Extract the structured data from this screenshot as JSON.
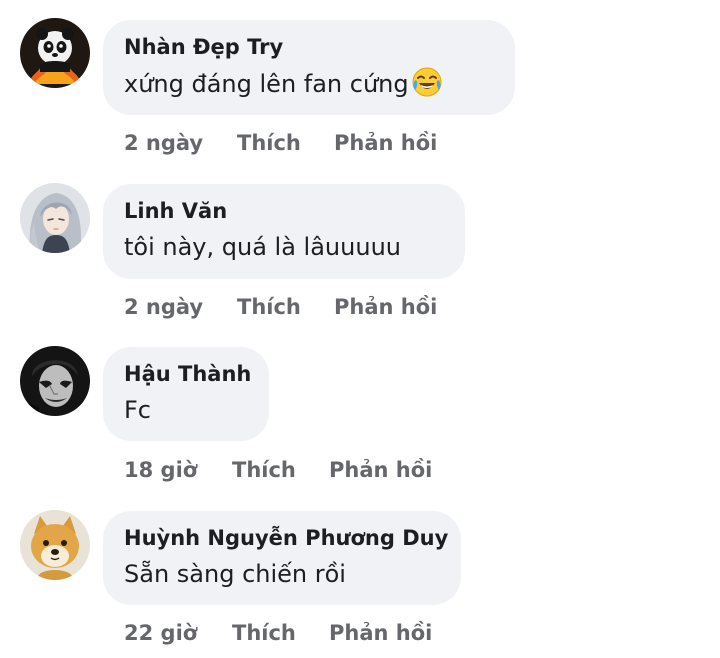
{
  "comments": [
    {
      "author": "Nhàn Đẹp Try",
      "text": "xứng đáng lên fan cứng",
      "emoji": "face-with-tears-of-joy-icon",
      "time": "2 ngày",
      "like_label": "Thích",
      "reply_label": "Phản hồi",
      "avatar": "panda-avatar"
    },
    {
      "author": "Linh Văn",
      "text": "tôi này, quá là lâuuuuu",
      "time": "2 ngày",
      "like_label": "Thích",
      "reply_label": "Phản hồi",
      "avatar": "silver-hair-character-avatar"
    },
    {
      "author": "Hậu Thành",
      "text": "Fc",
      "time": "18 giờ",
      "like_label": "Thích",
      "reply_label": "Phản hồi",
      "avatar": "joker-avatar"
    },
    {
      "author": "Huỳnh Nguyễn Phương Duy",
      "text": "Sẵn sàng chiến rồi",
      "time": "22 giờ",
      "like_label": "Thích",
      "reply_label": "Phản hồi",
      "avatar": "shiba-dog-avatar"
    }
  ],
  "colors": {
    "bubble_background": "#f0f2f5",
    "primary_text": "#1c1e21",
    "secondary_text": "#65676b"
  }
}
